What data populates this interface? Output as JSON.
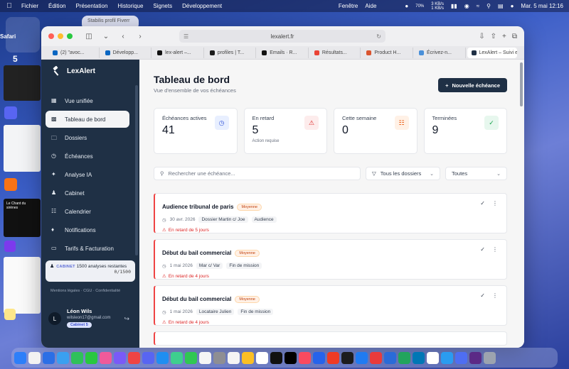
{
  "menubar": {
    "app": "Safari",
    "items": [
      "Fichier",
      "Édition",
      "Présentation",
      "Historique",
      "Signets",
      "Développement"
    ],
    "right_items": [
      "Fenêtre",
      "Aide"
    ],
    "battery": "70%",
    "net_up": "3 KB/s",
    "net_down": "1 KB/s",
    "datetime": "Mar. 5 mai  12:16"
  },
  "background": {
    "tab_label": "Stabilis profil Fiverr",
    "space_number": "5",
    "thumb_text": "Le Chant du\nsirènes"
  },
  "browser": {
    "url": "lexalert.fr",
    "tabs": [
      {
        "label": "(2) \"avoc...",
        "color": "#0a66c2"
      },
      {
        "label": "Développ...",
        "color": "#0a66c2"
      },
      {
        "label": "lex-alert –...",
        "color": "#111111"
      },
      {
        "label": "profiles | T...",
        "color": "#1a1a1a"
      },
      {
        "label": "Emails · R...",
        "color": "#111111"
      },
      {
        "label": "Résultats...",
        "color": "#ea4335"
      },
      {
        "label": "Product H...",
        "color": "#da552f"
      },
      {
        "label": "Écrivez-n...",
        "color": "#4a90d9"
      },
      {
        "label": "LexAlert – Suivi et g...",
        "color": "#1f3045",
        "active": true
      }
    ]
  },
  "sidebar": {
    "brand": "LexAlert",
    "items": [
      {
        "label": "Vue unifiée",
        "icon": "grid-icon"
      },
      {
        "label": "Tableau de bord",
        "icon": "dashboard-icon",
        "active": true
      },
      {
        "label": "Dossiers",
        "icon": "folder-icon"
      },
      {
        "label": "Échéances",
        "icon": "clock-icon"
      },
      {
        "label": "Analyse IA",
        "icon": "sparkle-icon"
      },
      {
        "label": "Cabinet",
        "icon": "people-icon"
      },
      {
        "label": "Calendrier",
        "icon": "calendar-icon"
      },
      {
        "label": "Notifications",
        "icon": "bell-icon"
      },
      {
        "label": "Tarifs & Facturation",
        "icon": "card-icon"
      }
    ],
    "credits": {
      "badge": "CABINET",
      "text": "1500 analyses restantes",
      "count": "0/1500"
    },
    "legal": "Mentions légales · CGU · Confidentialité",
    "user": {
      "initial": "L",
      "name": "Léon Wils",
      "email": "wilsleon17@gmail.com",
      "plan": "Cabinet 5"
    }
  },
  "main": {
    "title": "Tableau de bord",
    "subtitle": "Vue d'ensemble de vos échéances",
    "new_button": "Nouvelle échéance",
    "stats": [
      {
        "label": "Échéances actives",
        "value": "41",
        "note": "",
        "icon": "clock-icon",
        "bg": "#e8efff",
        "fg": "#3b5bdb"
      },
      {
        "label": "En retard",
        "value": "5",
        "note": "Action requise",
        "icon": "warning-icon",
        "bg": "#fdecec",
        "fg": "#dc2626"
      },
      {
        "label": "Cette semaine",
        "value": "0",
        "note": "",
        "icon": "calendar-icon",
        "bg": "#fff1e6",
        "fg": "#ea580c"
      },
      {
        "label": "Terminées",
        "value": "9",
        "note": "",
        "icon": "check-circle-icon",
        "bg": "#e7f7ee",
        "fg": "#16a34a"
      }
    ],
    "search_placeholder": "Rechercher une échéance...",
    "folder_filter": "Tous les dossiers",
    "status_filter": "Toutes",
    "deadlines": [
      {
        "title": "Audience tribunal de paris",
        "priority": "Moyenne",
        "date": "30 avr. 2026",
        "folder": "Dossier Martin c/ Joe",
        "type": "Audience",
        "late": "En retard de 5 jours"
      },
      {
        "title": "Début du bail commercial",
        "priority": "Moyenne",
        "date": "1 mai 2026",
        "folder": "Mar c/ Var",
        "type": "Fin de mission",
        "late": "En retard de 4 jours"
      },
      {
        "title": "Début du bail commercial",
        "priority": "Moyenne",
        "date": "1 mai 2026",
        "folder": "Locataire Julien",
        "type": "Fin de mission",
        "late": "En retard de 4 jours"
      }
    ]
  },
  "dock": {
    "colors": [
      "#2d7ff9",
      "#f2f2f2",
      "#2b6fe6",
      "#3aa0f0",
      "#2fc15a",
      "#28c840",
      "#f05a9a",
      "#7a5af8",
      "#ef4444",
      "#5865f2",
      "#1f8ef1",
      "#3ecf8e",
      "#30c852",
      "#f5f5f5",
      "#8e8e93",
      "#f4f4f4",
      "#fbbf24",
      "#ffffff",
      "#111111",
      "#000000",
      "#fa4a5f",
      "#2563eb",
      "#ef3b24",
      "#1c1c1e",
      "#1f7bf2",
      "#e83b3b",
      "#2a6bd8",
      "#22a45d",
      "#0077b5",
      "#ffffff",
      "#2a9cf0",
      "#4e6ef2",
      "#5b2a86",
      "#9ca3af"
    ]
  }
}
